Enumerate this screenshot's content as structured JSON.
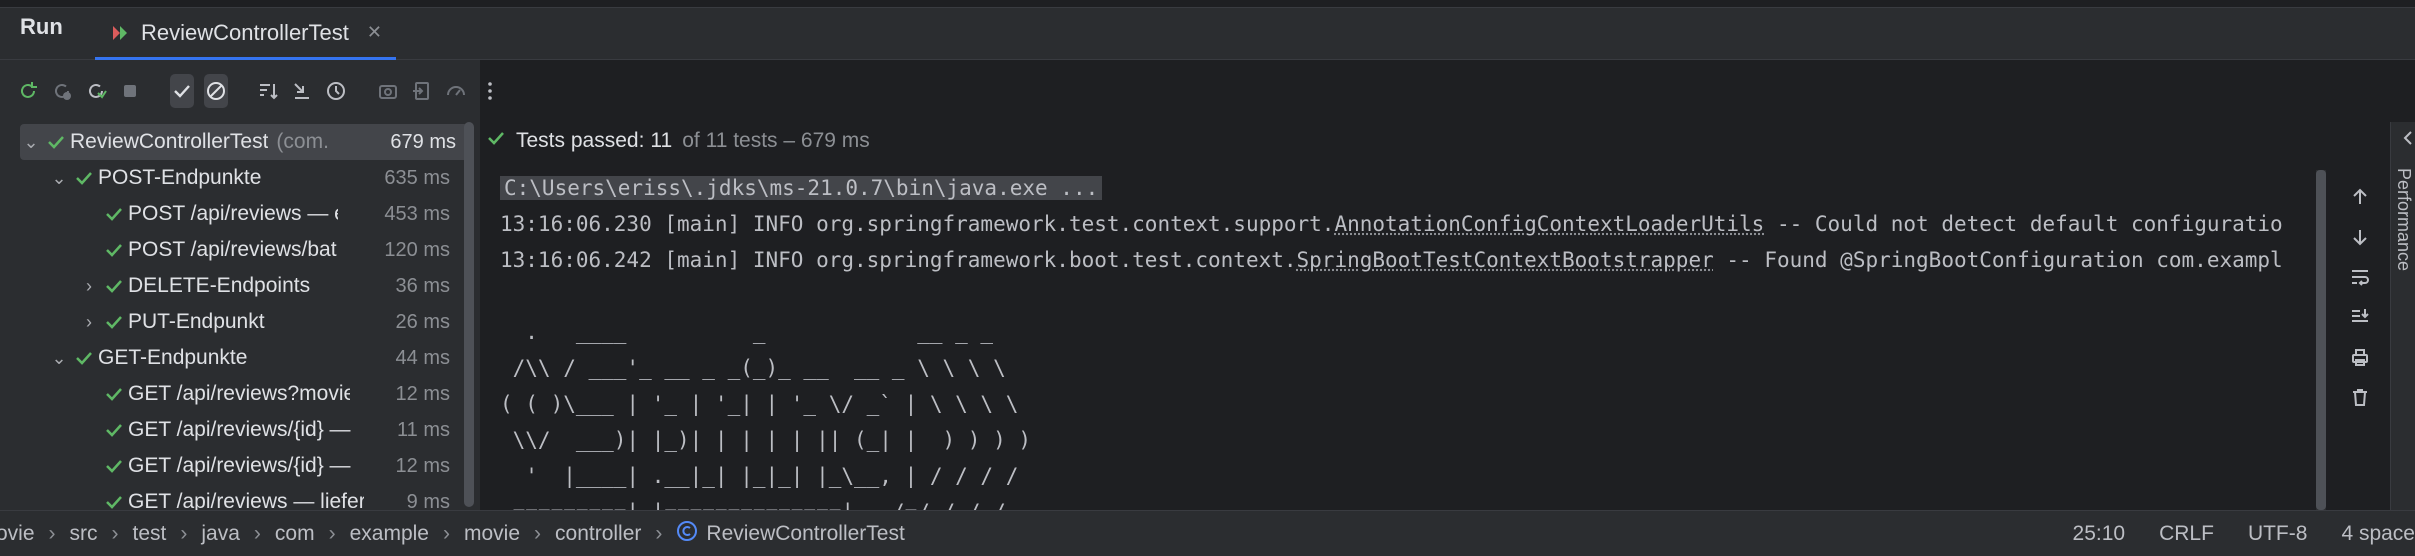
{
  "window": {
    "tool_window_title": "Run",
    "tab_label": "ReviewControllerTest"
  },
  "toolbar": {
    "buttons": [
      "rerun-icon",
      "rerun-failed-icon",
      "toggle-autotest-icon",
      "stop-icon",
      "show-passed-icon",
      "show-ignored-icon",
      "sort-icon",
      "collapse-icon",
      "history-icon",
      "screenshot-icon",
      "export-icon",
      "coverage-icon",
      "more-icon"
    ]
  },
  "tree": {
    "rows": [
      {
        "name": "ReviewControllerTest",
        "pkg": "(com.",
        "time": "679 ms",
        "expanded": true
      },
      {
        "name": "POST-Endpunkte",
        "time": "635 ms",
        "expanded": true
      },
      {
        "name": "POST /api/reviews — e",
        "time": "453 ms"
      },
      {
        "name": "POST /api/reviews/bat",
        "time": "120 ms"
      },
      {
        "name": "DELETE-Endpoints",
        "time": "36 ms",
        "expanded": false
      },
      {
        "name": "PUT-Endpunkt",
        "time": "26 ms",
        "expanded": false
      },
      {
        "name": "GET-Endpunkte",
        "time": "44 ms",
        "expanded": true
      },
      {
        "name": "GET /api/reviews?movie",
        "time": "12 ms"
      },
      {
        "name": "GET /api/reviews/{id} —",
        "time": "11 ms"
      },
      {
        "name": "GET /api/reviews/{id} —",
        "time": "12 ms"
      },
      {
        "name": "GET /api/reviews — liefer",
        "time": "9 ms"
      }
    ]
  },
  "results": {
    "passed_label": "Tests passed:",
    "passed_count": "11",
    "rest": "of 11 tests – 679 ms"
  },
  "console": {
    "cmd": "C:\\Users\\eriss\\.jdks\\ms-21.0.7\\bin\\java.exe ...",
    "log1_prefix": "13:16:06.230 [main] INFO org.springframework.test.context.support.",
    "log1_class": "AnnotationConfigContextLoaderUtils",
    "log1_suffix": " -- Could not detect default configuratio",
    "log2_prefix": "13:16:06.242 [main] INFO org.springframework.boot.test.context.",
    "log2_class": "SpringBootTestContextBootstrapper",
    "log2_suffix": " -- Found @SpringBootConfiguration com.exampl",
    "banner": [
      "  .   ____          _            __ _ _",
      " /\\\\ / ___'_ __ _ _(_)_ __  __ _ \\ \\ \\ \\",
      "( ( )\\___ | '_ | '_| | '_ \\/ _` | \\ \\ \\ \\",
      " \\\\/  ___)| |_)| | | | | || (_| |  ) ) ) )",
      "  '  |____| .__|_| |_|_| |_\\__, | / / / /",
      " =========|_|==============|___/=/_/_/_/"
    ]
  },
  "right_strip": {
    "label": "Performance"
  },
  "statusbar": {
    "crumbs": [
      "ovie",
      "src",
      "test",
      "java",
      "com",
      "example",
      "movie",
      "controller",
      "ReviewControllerTest"
    ],
    "position": "25:10",
    "line_ending": "CRLF",
    "encoding": "UTF-8",
    "indent": "4 space"
  },
  "colors": {
    "accent": "#3574f0",
    "pass_green": "#5fb865",
    "panel_bg": "#2b2d30",
    "console_bg": "#1e1f22"
  }
}
